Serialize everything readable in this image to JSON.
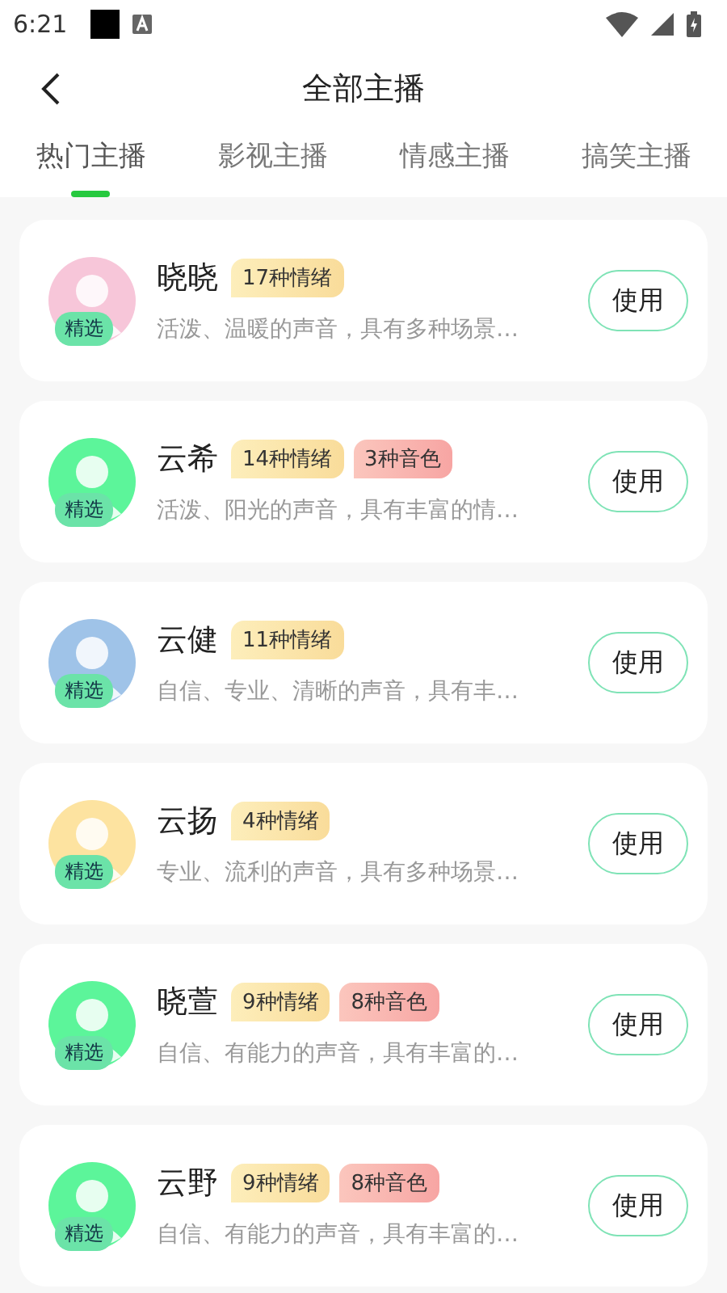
{
  "status_bar": {
    "time": "6:21"
  },
  "header": {
    "title": "全部主播"
  },
  "tabs": [
    {
      "label": "热门主播",
      "selected": true
    },
    {
      "label": "影视主播",
      "selected": false
    },
    {
      "label": "情感主播",
      "selected": false
    },
    {
      "label": "搞笑主播",
      "selected": false
    }
  ],
  "anchors": [
    {
      "name": "晓晓",
      "color": "#f7c6d9",
      "badge": "精选",
      "tags": [
        {
          "kind": "emotion",
          "label": "17种情绪"
        }
      ],
      "description": "活泼、温暖的声音，具有多种场景…",
      "button": "使用"
    },
    {
      "name": "云希",
      "color": "#5cf59a",
      "badge": "精选",
      "tags": [
        {
          "kind": "emotion",
          "label": "14种情绪"
        },
        {
          "kind": "timbre",
          "label": "3种音色"
        }
      ],
      "description": "活泼、阳光的声音，具有丰富的情…",
      "button": "使用"
    },
    {
      "name": "云健",
      "color": "#9fc3e8",
      "badge": "精选",
      "tags": [
        {
          "kind": "emotion",
          "label": "11种情绪"
        }
      ],
      "description": "自信、专业、清晰的声音，具有丰…",
      "button": "使用"
    },
    {
      "name": "云扬",
      "color": "#fde3a0",
      "badge": "精选",
      "tags": [
        {
          "kind": "emotion",
          "label": "4种情绪"
        }
      ],
      "description": "专业、流利的声音，具有多种场景…",
      "button": "使用"
    },
    {
      "name": "晓萱",
      "color": "#5cf59a",
      "badge": "精选",
      "tags": [
        {
          "kind": "emotion",
          "label": "9种情绪"
        },
        {
          "kind": "timbre",
          "label": "8种音色"
        }
      ],
      "description": "自信、有能力的声音，具有丰富的…",
      "button": "使用"
    },
    {
      "name": "云野",
      "color": "#5cf59a",
      "badge": "精选",
      "tags": [
        {
          "kind": "emotion",
          "label": "9种情绪"
        },
        {
          "kind": "timbre",
          "label": "8种音色"
        }
      ],
      "description": "自信、有能力的声音，具有丰富的…",
      "button": "使用"
    }
  ]
}
